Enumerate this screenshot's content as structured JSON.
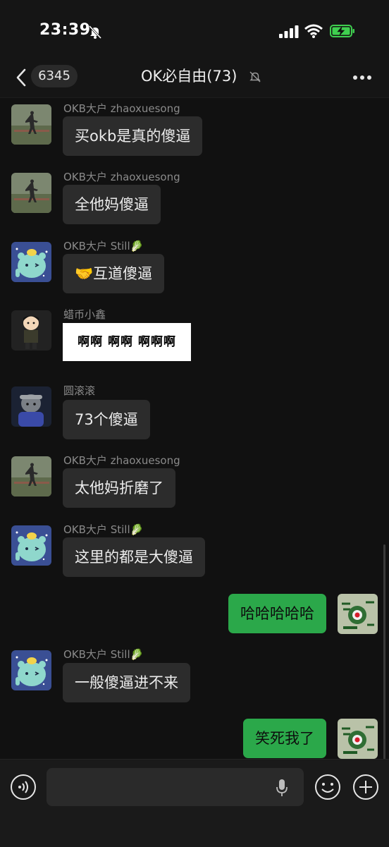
{
  "status_bar": {
    "time": "23:39",
    "icons": [
      "bell-slash-icon",
      "signal-icon",
      "wifi-icon",
      "battery-charging-icon"
    ]
  },
  "nav": {
    "back_count": "6345",
    "title": "OK必自由(73)",
    "icons": [
      "back-chevron-icon",
      "mute-bell-icon",
      "more-icon"
    ]
  },
  "messages": [
    {
      "sender": "OKB大户 zhaoxuesong",
      "text": "买okb是真的傻逼"
    },
    {
      "sender": "OKB大户 zhaoxuesong",
      "text": "全他妈傻逼"
    },
    {
      "sender": "OKB大户 Still🥬",
      "text": "🤝互道傻逼"
    },
    {
      "sender": "蜡币小鑫",
      "sticker_text": "啊啊 啊啊 啊啊啊"
    },
    {
      "sender": "圆滚滚",
      "text": "73个傻逼"
    },
    {
      "sender": "OKB大户 zhaoxuesong",
      "text": "太他妈折磨了"
    },
    {
      "sender": "OKB大户 Still🥬",
      "text": "这里的都是大傻逼"
    },
    {
      "own": true,
      "text": "哈哈哈哈哈"
    },
    {
      "sender": "OKB大户 Still🥬",
      "text": "一般傻逼进不来"
    },
    {
      "own": true,
      "text": "笑死我了"
    }
  ],
  "input_bar": {
    "value": "",
    "icons": [
      "voice-icon",
      "mic-icon",
      "emoji-icon",
      "plus-icon"
    ]
  },
  "colors": {
    "background": "#111111",
    "incoming_bubble": "#2c2c2c",
    "outgoing_bubble": "#2ba84a",
    "sender_text": "#8a8a8a"
  }
}
